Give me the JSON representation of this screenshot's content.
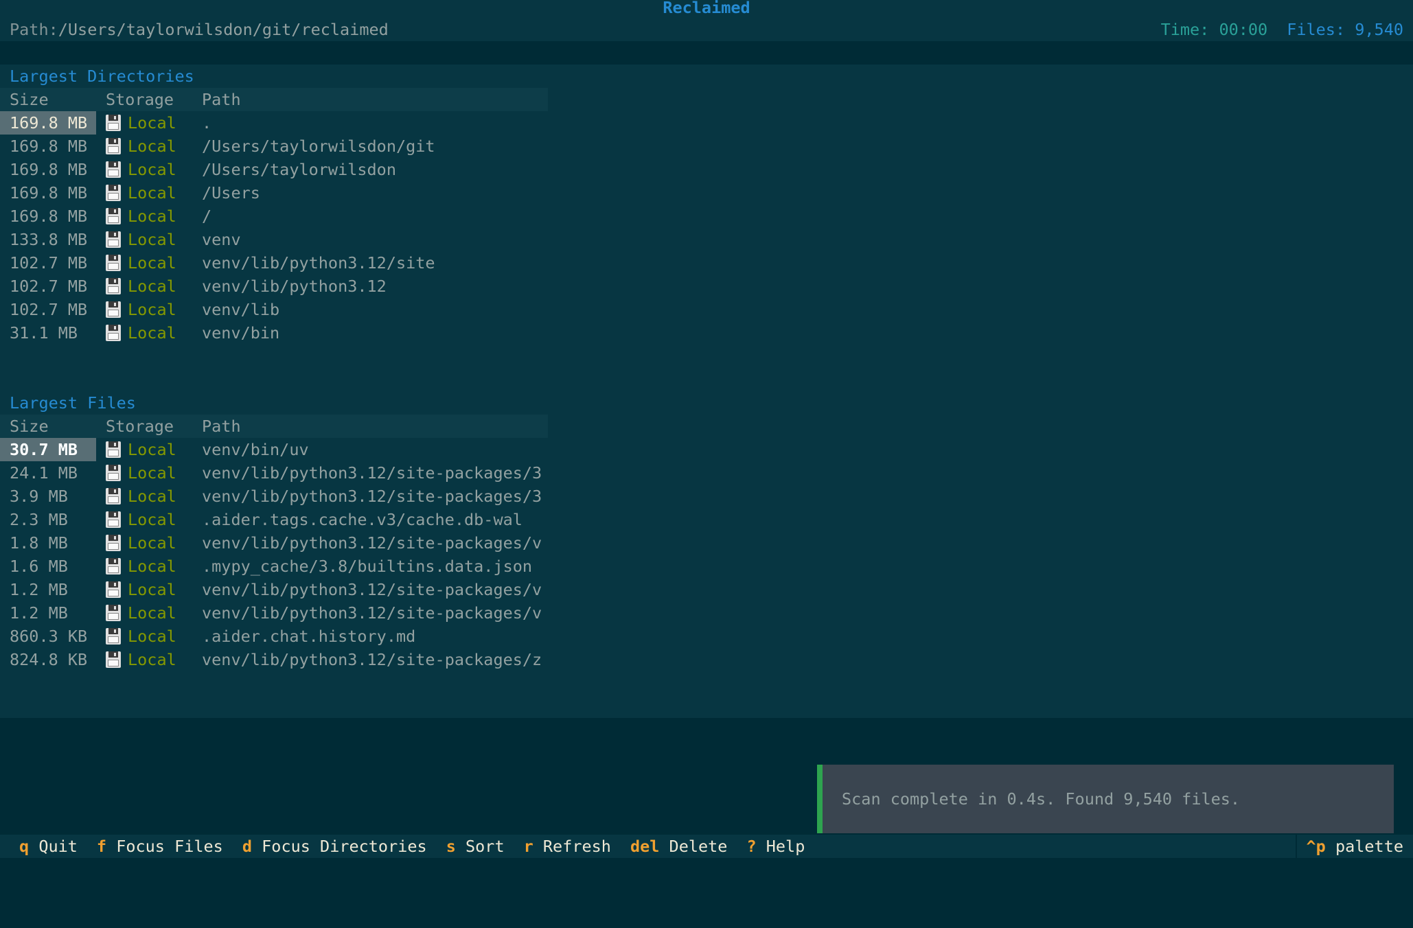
{
  "header": {
    "title": "Reclaimed",
    "path_label": "Path:",
    "path_value": "/Users/taylorwilsdon/git/reclaimed",
    "time": "Time: 00:00",
    "files": "Files: 9,540"
  },
  "dirs": {
    "title": "Largest Directories",
    "columns": {
      "size": "Size",
      "storage": "Storage",
      "path": "Path"
    },
    "rows": [
      {
        "size": "169.8 MB",
        "storage": "Local",
        "path": "."
      },
      {
        "size": "169.8 MB",
        "storage": "Local",
        "path": "/Users/taylorwilsdon/git"
      },
      {
        "size": "169.8 MB",
        "storage": "Local",
        "path": "/Users/taylorwilsdon"
      },
      {
        "size": "169.8 MB",
        "storage": "Local",
        "path": "/Users"
      },
      {
        "size": "169.8 MB",
        "storage": "Local",
        "path": "/"
      },
      {
        "size": "133.8 MB",
        "storage": "Local",
        "path": "venv"
      },
      {
        "size": "102.7 MB",
        "storage": "Local",
        "path": "venv/lib/python3.12/site"
      },
      {
        "size": "102.7 MB",
        "storage": "Local",
        "path": "venv/lib/python3.12"
      },
      {
        "size": "102.7 MB",
        "storage": "Local",
        "path": "venv/lib"
      },
      {
        "size": "31.1 MB",
        "storage": "Local",
        "path": "venv/bin"
      }
    ]
  },
  "files": {
    "title": "Largest Files",
    "columns": {
      "size": "Size",
      "storage": "Storage",
      "path": "Path"
    },
    "rows": [
      {
        "size": "30.7 MB",
        "storage": "Local",
        "path": "venv/bin/uv"
      },
      {
        "size": "24.1 MB",
        "storage": "Local",
        "path": "venv/lib/python3.12/site-packages/3"
      },
      {
        "size": "3.9 MB",
        "storage": "Local",
        "path": "venv/lib/python3.12/site-packages/3"
      },
      {
        "size": "2.3 MB",
        "storage": "Local",
        "path": ".aider.tags.cache.v3/cache.db-wal"
      },
      {
        "size": "1.8 MB",
        "storage": "Local",
        "path": "venv/lib/python3.12/site-packages/v"
      },
      {
        "size": "1.6 MB",
        "storage": "Local",
        "path": ".mypy_cache/3.8/builtins.data.json"
      },
      {
        "size": "1.2 MB",
        "storage": "Local",
        "path": "venv/lib/python3.12/site-packages/v"
      },
      {
        "size": "1.2 MB",
        "storage": "Local",
        "path": "venv/lib/python3.12/site-packages/v"
      },
      {
        "size": "860.3 KB",
        "storage": "Local",
        "path": ".aider.chat.history.md"
      },
      {
        "size": "824.8 KB",
        "storage": "Local",
        "path": "venv/lib/python3.12/site-packages/z"
      }
    ]
  },
  "toast": {
    "message": "Scan complete in 0.4s. Found 9,540 files."
  },
  "footer": {
    "items": [
      {
        "key": "q",
        "label": "Quit"
      },
      {
        "key": "f",
        "label": "Focus Files"
      },
      {
        "key": "d",
        "label": "Focus Directories"
      },
      {
        "key": "s",
        "label": "Sort"
      },
      {
        "key": "r",
        "label": "Refresh"
      },
      {
        "key": "del",
        "label": "Delete"
      },
      {
        "key": "?",
        "label": "Help"
      }
    ],
    "palette_key": "^p",
    "palette_label": "palette"
  },
  "colors": {
    "background": "#002b36",
    "panel": "#073642",
    "accent": "#268bd2",
    "storage_green": "#859900",
    "key_orange": "#f0a030",
    "toast_border": "#2ea44f"
  },
  "icons": {
    "storage": "floppy-disk-icon"
  }
}
